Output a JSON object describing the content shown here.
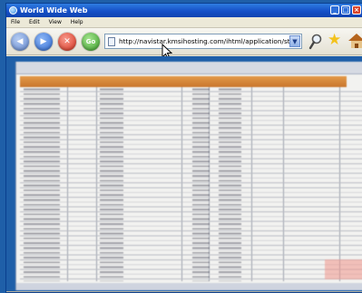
{
  "window": {
    "title": "World Wide Web",
    "controls": {
      "minimize": "_",
      "maximize": "□",
      "close": "×"
    }
  },
  "menubar": {
    "items": [
      "File",
      "Edit",
      "View",
      "Help"
    ]
  },
  "toolbar": {
    "back_icon": "back-arrow-icon",
    "forward_icon": "forward-arrow-icon",
    "stop_icon": "stop-icon",
    "go_label": "Go",
    "address_url": "http://navistar.kmsihosting.com/ihtml/application/stu",
    "search_icon": "magnifier-icon",
    "favorites_icon": "star-icon",
    "home_icon": "home-icon"
  },
  "colors": {
    "titlebar": "#1550c8",
    "desktop": "#1f5fa8",
    "sheet_header": "#c8762c",
    "highlight": "#f0968c"
  }
}
